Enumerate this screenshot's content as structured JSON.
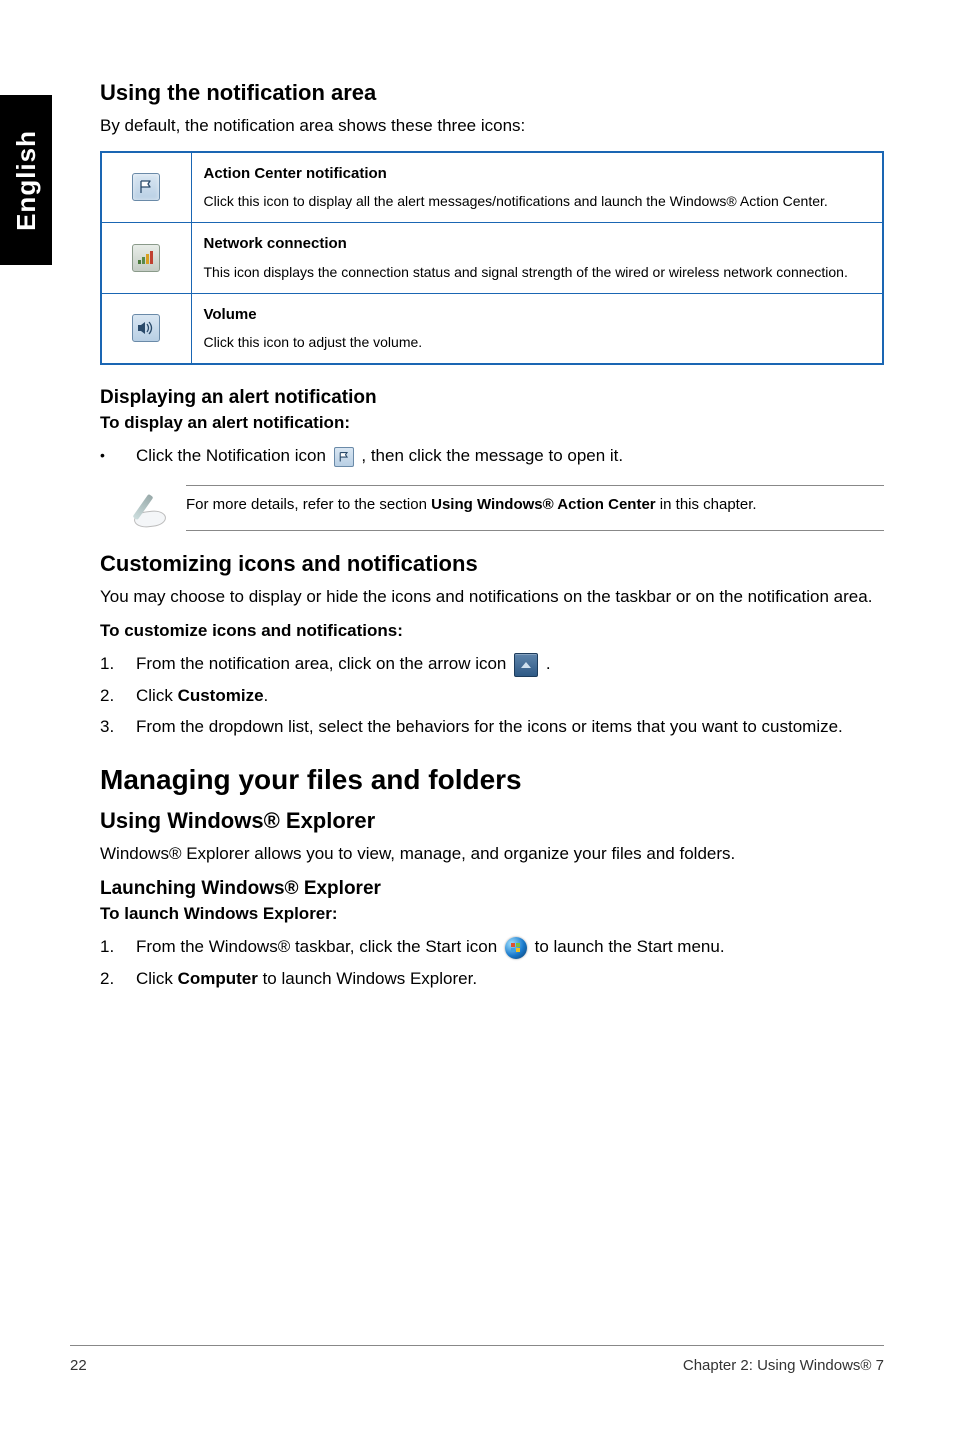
{
  "sideTab": "English",
  "h2_notif": "Using the notification area",
  "p_notif": "By default, the notification area shows these three icons:",
  "table": {
    "r1": {
      "title": "Action Center notification",
      "body": "Click this icon to display all the alert messages/notifications and launch the Windows® Action Center."
    },
    "r2": {
      "title": "Network connection",
      "body": "This icon displays the connection status and signal strength of the wired or wireless network connection."
    },
    "r3": {
      "title": "Volume",
      "body": "Click this icon to adjust the volume."
    }
  },
  "h3_disp": "Displaying an alert notification",
  "bold_disp": "To display an alert notification:",
  "bullet1a": "Click the Notification icon ",
  "bullet1b": ", then click the message to open it.",
  "note1a": "For more details, refer to the section ",
  "note1b": "Using Windows® Action Center",
  "note1c": " in this chapter.",
  "h2_cust": "Customizing icons and notifications",
  "p_cust": "You may choose to display or hide the icons and notifications on the taskbar or on the notification area.",
  "bold_cust": "To customize icons and notifications:",
  "s1a": "From the notification area, click on the arrow icon ",
  "s1b": ".",
  "s2a": "Click ",
  "s2b": "Customize",
  "s2c": ".",
  "s3": "From the dropdown list, select the behaviors for the icons or items that you want to customize.",
  "h1_manage": "Managing your files and folders",
  "h2_uwe": "Using Windows® Explorer",
  "p_uwe": "Windows® Explorer allows you to view, manage, and organize your files and folders.",
  "h3_lwe": "Launching Windows® Explorer",
  "bold_lwe": "To launch Windows Explorer:",
  "l1a": "From the Windows® taskbar, click the Start icon ",
  "l1b": " to launch the Start menu.",
  "l2a": "Click ",
  "l2b": "Computer",
  "l2c": " to launch Windows Explorer.",
  "footerLeft": "22",
  "footerRight": "Chapter 2: Using Windows® 7"
}
